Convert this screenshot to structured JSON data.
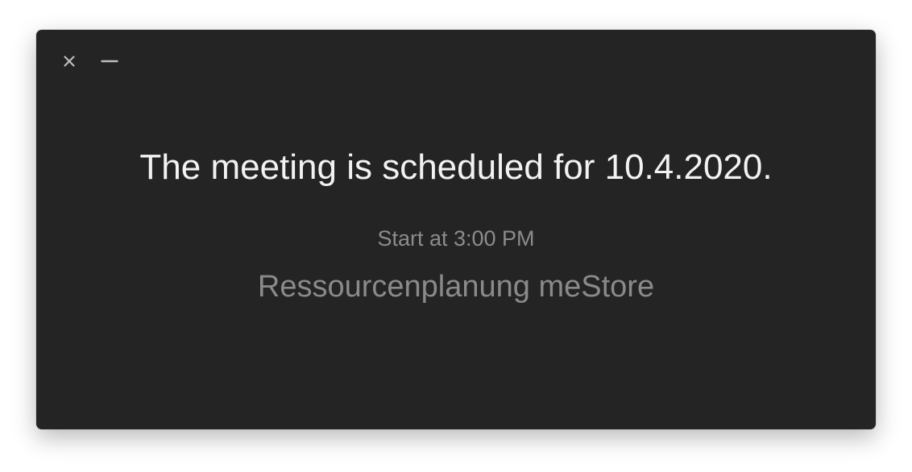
{
  "window": {
    "controls": {
      "close_icon": "close-icon",
      "minimize_icon": "minimize-icon"
    }
  },
  "notification": {
    "title": "The meeting is scheduled for 10.4.2020.",
    "start_time": "Start at 3:00 PM",
    "meeting_name": "Ressourcenplanung meStore"
  },
  "colors": {
    "background": "#242424",
    "title": "#f2f2f2",
    "secondary": "#8c8c8c",
    "controls": "#bdbdbd"
  }
}
